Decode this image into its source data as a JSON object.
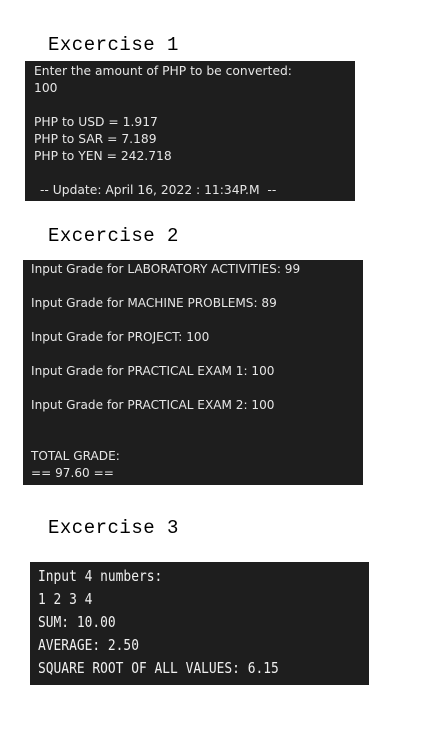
{
  "exercises": [
    {
      "title": "Excercise 1",
      "output": [
        "Enter the amount of PHP to be converted:",
        "100",
        "",
        "PHP to USD = 1.917",
        "PHP to SAR = 7.189",
        "PHP to YEN = 242.718",
        "",
        "-- Update: April 16, 2022 : 11:34P.M  --"
      ]
    },
    {
      "title": "Excercise 2",
      "output": [
        "Input Grade for LABORATORY ACTIVITIES: 99",
        "Input Grade for MACHINE PROBLEMS: 89",
        "Input Grade for PROJECT: 100",
        "Input Grade for PRACTICAL EXAM 1: 100",
        "Input Grade for PRACTICAL EXAM 2: 100",
        "TOTAL GRADE:",
        "== 97.60 =="
      ]
    },
    {
      "title": "Excercise 3",
      "output": [
        "Input 4 numbers:",
        "1 2 3 4",
        "SUM: 10.00",
        "AVERAGE: 2.50",
        "SQUARE ROOT OF ALL VALUES: 6.15"
      ]
    }
  ],
  "colors": {
    "terminal_bg": "#1e1e1e",
    "terminal_text": "#e6e6e6",
    "page_bg": "#ffffff"
  }
}
